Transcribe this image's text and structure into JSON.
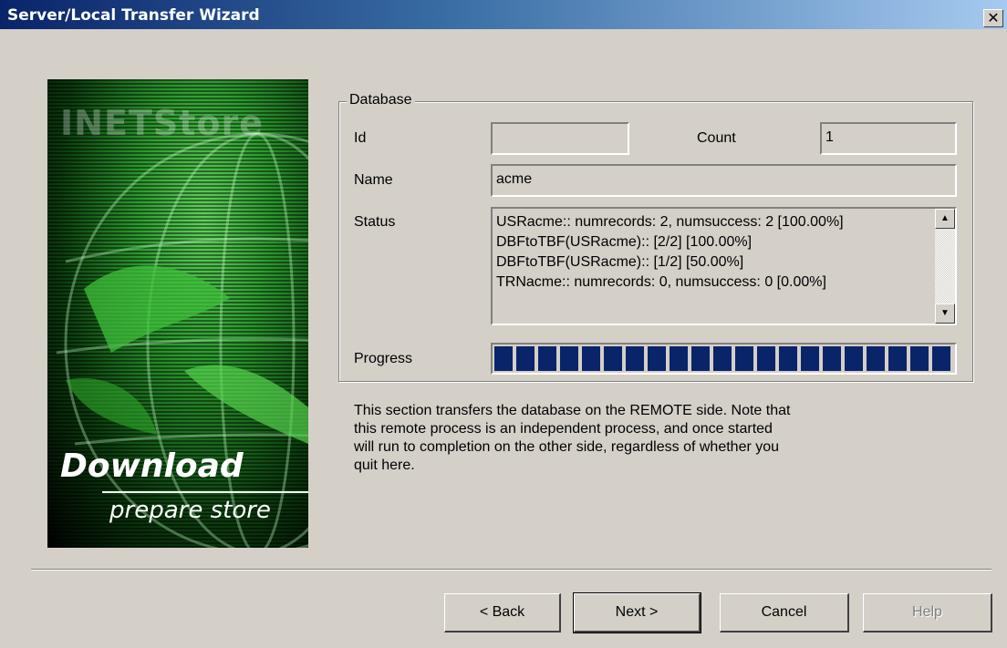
{
  "window": {
    "title": "Server/Local Transfer Wizard",
    "close_glyph": "✕"
  },
  "banner": {
    "watermark": "INETStore",
    "title": "Download",
    "subtitle": "prepare store"
  },
  "database": {
    "legend": "Database",
    "id_label": "Id",
    "id_value": "",
    "count_label": "Count",
    "count_value": "1",
    "name_label": "Name",
    "name_value": "acme",
    "status_label": "Status",
    "status_lines": [
      "USRacme:: numrecords: 2, numsuccess: 2 [100.00%]",
      "DBFtoTBF(USRacme):: [2/2] [100.00%]",
      "DBFtoTBF(USRacme):: [1/2] [50.00%]",
      "TRNacme:: numrecords: 0, numsuccess: 0 [0.00%]"
    ],
    "progress_label": "Progress",
    "progress_fraction": 1.0
  },
  "description": "This section transfers the database on the REMOTE side. Note that this remote process is an independent process, and once started will run to completion on the other side, regardless of whether you quit here.",
  "buttons": {
    "back": "< Back",
    "next": "Next >",
    "cancel": "Cancel",
    "help": "Help"
  },
  "icons": {
    "scroll_up": "up-arrow-icon",
    "scroll_down": "down-arrow-icon",
    "close": "close-icon"
  },
  "colors": {
    "progress": "#0a246a",
    "titlebar": "#0a246a"
  }
}
